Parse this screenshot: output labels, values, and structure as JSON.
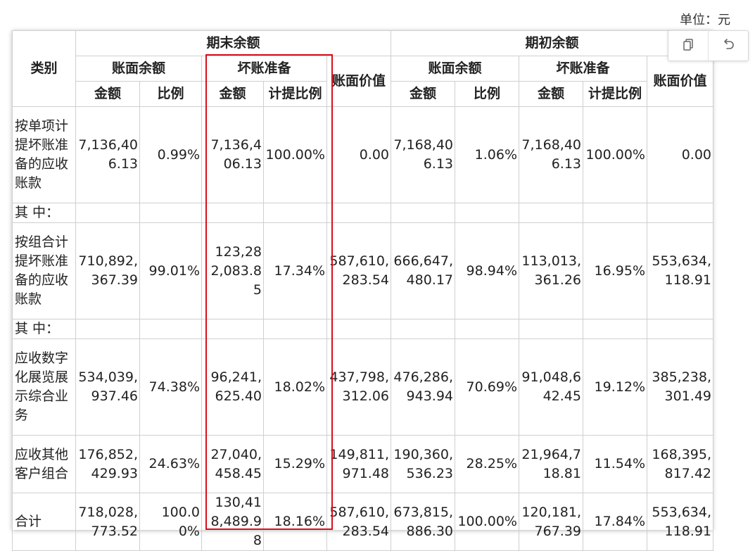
{
  "unit": "单位：元",
  "headers": {
    "category": "类别",
    "closing": "期末余额",
    "opening": "期初余额",
    "book_balance": "账面余额",
    "bad_debt": "坏账准备",
    "book_value": "账面价值",
    "amount": "金额",
    "ratio": "比例",
    "provision_ratio": "计提比例"
  },
  "rows": [
    {
      "label": "按单项计提坏账准备的应收账款",
      "cells": [
        "7,136,406.13",
        "0.99%",
        "7,136,406.13",
        "100.00%",
        "0.00",
        "7,168,406.13",
        "1.06%",
        "7,168,406.13",
        "100.00%",
        "0.00"
      ]
    },
    {
      "label": "其 中：",
      "cells": [
        "",
        "",
        "",
        "",
        "",
        "",
        "",
        "",
        "",
        ""
      ]
    },
    {
      "label": "按组合计提坏账准备的应收账款",
      "cells": [
        "710,892,367.39",
        "99.01%",
        "123,282,083.85",
        "17.34%",
        "587,610,283.54",
        "666,647,480.17",
        "98.94%",
        "113,013,361.26",
        "16.95%",
        "553,634,118.91"
      ]
    },
    {
      "label": "其 中：",
      "cells": [
        "",
        "",
        "",
        "",
        "",
        "",
        "",
        "",
        "",
        ""
      ]
    },
    {
      "label": "应收数字化展览展示综合业务",
      "cells": [
        "534,039,937.46",
        "74.38%",
        "96,241,625.40",
        "18.02%",
        "437,798,312.06",
        "476,286,943.94",
        "70.69%",
        "91,048,642.45",
        "19.12%",
        "385,238,301.49"
      ]
    },
    {
      "label": "应收其他客户组合",
      "cells": [
        "176,852,429.93",
        "24.63%",
        "27,040,458.45",
        "15.29%",
        "149,811,971.48",
        "190,360,536.23",
        "28.25%",
        "21,964,718.81",
        "11.54%",
        "168,395,817.42"
      ]
    },
    {
      "label": "合计",
      "cells": [
        "718,028,773.52",
        "100.00%",
        "130,418,489.98",
        "18.16%",
        "587,610,283.54",
        "673,815,886.30",
        "100.00%",
        "120,181,767.39",
        "17.84%",
        "553,634,118.91"
      ]
    }
  ],
  "colors": {
    "highlight": "#d7101b",
    "grid": "#cfcfcf"
  },
  "icons": {
    "copy": "copy-icon",
    "undo": "undo-icon"
  }
}
